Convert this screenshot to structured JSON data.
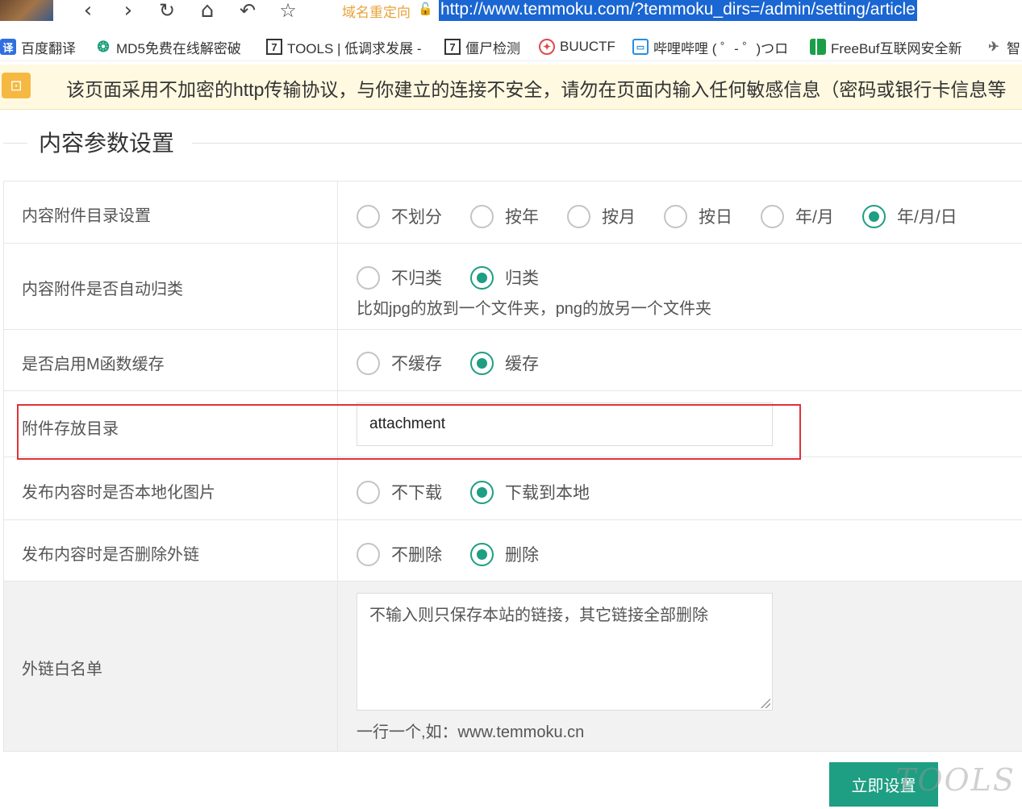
{
  "browser": {
    "redirect_label": "域名重定向",
    "url": "http://www.temmoku.com/?temmoku_dirs=/admin/setting/article"
  },
  "bookmarks": [
    {
      "label": "百度翻译",
      "icon": "translate-icon"
    },
    {
      "label": "MD5免费在线解密破",
      "icon": "md5-icon"
    },
    {
      "label": "TOOLS | 低调求发展 -",
      "icon": "tools-icon"
    },
    {
      "label": "僵尸检测",
      "icon": "tools-icon"
    },
    {
      "label": "BUUCTF",
      "icon": "buuctf-icon"
    },
    {
      "label": "哔哩哔哩 ( ゜- ゜)つロ",
      "icon": "bilibili-icon"
    },
    {
      "label": "FreeBuf互联网安全新",
      "icon": "freebuf-icon"
    },
    {
      "label": "智",
      "icon": "ai-icon"
    }
  ],
  "warning": {
    "text": "该页面采用不加密的http传输协议，与你建立的连接不安全，请勿在页面内输入任何敏感信息（密码或银行卡信息等"
  },
  "section": {
    "title": "内容参数设置"
  },
  "settings": {
    "attach_dir_split": {
      "label": "内容附件目录设置",
      "options": [
        "不划分",
        "按年",
        "按月",
        "按日",
        "年/月",
        "年/月/日"
      ],
      "selected": "年/月/日"
    },
    "auto_classify": {
      "label": "内容附件是否自动归类",
      "options": [
        "不归类",
        "归类"
      ],
      "selected": "归类",
      "hint": "比如jpg的放到一个文件夹，png的放另一个文件夹"
    },
    "m_cache": {
      "label": "是否启用M函数缓存",
      "options": [
        "不缓存",
        "缓存"
      ],
      "selected": "缓存"
    },
    "attach_path": {
      "label": "附件存放目录",
      "value": "attachment"
    },
    "localize_images": {
      "label": "发布内容时是否本地化图片",
      "options": [
        "不下载",
        "下载到本地"
      ],
      "selected": "下载到本地"
    },
    "remove_external_links": {
      "label": "发布内容时是否删除外链",
      "options": [
        "不删除",
        "删除"
      ],
      "selected": "删除"
    },
    "link_whitelist": {
      "label": "外链白名单",
      "placeholder": "不输入则只保存本站的链接，其它链接全部删除",
      "hint": "一行一个,如：www.temmoku.cn"
    }
  },
  "submit_label": "立即设置",
  "watermark": "TOOLS",
  "colors": {
    "accent": "#1e9e82",
    "url_highlight": "#1a66d2",
    "annotation": "#e0323a",
    "warning_bg": "#fff9e1"
  }
}
